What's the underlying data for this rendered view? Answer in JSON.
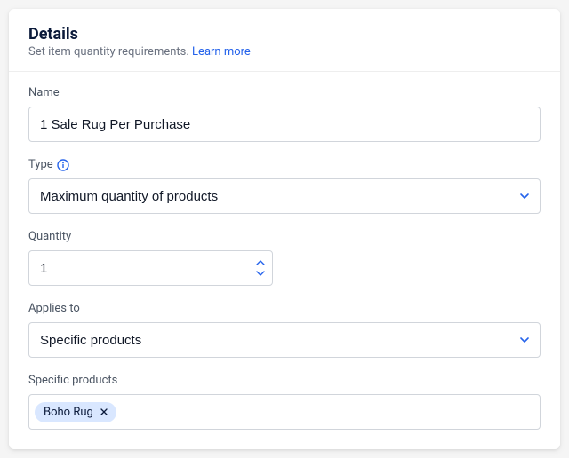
{
  "header": {
    "title": "Details",
    "subtitle": "Set item quantity requirements.",
    "learn_more": "Learn more"
  },
  "fields": {
    "name": {
      "label": "Name",
      "value": "1 Sale Rug Per Purchase"
    },
    "type": {
      "label": "Type",
      "value": "Maximum quantity of products"
    },
    "quantity": {
      "label": "Quantity",
      "value": "1"
    },
    "applies_to": {
      "label": "Applies to",
      "value": "Specific products"
    },
    "specific_products": {
      "label": "Specific products",
      "tags": [
        "Boho Rug"
      ]
    }
  }
}
